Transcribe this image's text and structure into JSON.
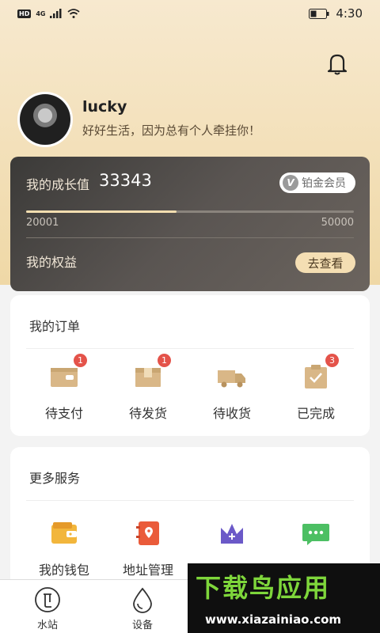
{
  "status_bar": {
    "hd": "HD",
    "network": "4G",
    "time": "4:30"
  },
  "profile": {
    "username": "lucky",
    "motto": "好好生活，因为总有个人牵挂你！"
  },
  "growth": {
    "label": "我的成长值",
    "value": "33343",
    "vip_level": "铂金会员",
    "vip_icon_letter": "V",
    "progress_min": "20001",
    "progress_max": "50000",
    "progress_fraction": 0.46,
    "benefits_label": "我的权益",
    "view_button": "去查看"
  },
  "orders": {
    "title": "我的订单",
    "items": [
      {
        "label": "待支付",
        "badge": "1",
        "icon": "wallet-card-icon"
      },
      {
        "label": "待发货",
        "badge": "1",
        "icon": "package-box-icon"
      },
      {
        "label": "待收货",
        "badge": "",
        "icon": "delivery-truck-icon"
      },
      {
        "label": "已完成",
        "badge": "3",
        "icon": "clipboard-check-icon"
      }
    ]
  },
  "services": {
    "title": "更多服务",
    "items": [
      {
        "label": "我的钱包",
        "icon": "wallet-icon"
      },
      {
        "label": "地址管理",
        "icon": "address-book-icon"
      },
      {
        "label": "",
        "icon": "crown-icon"
      },
      {
        "label": "",
        "icon": "message-icon"
      }
    ]
  },
  "tabs": [
    {
      "label": "水站",
      "icon": "water-station-icon"
    },
    {
      "label": "设备",
      "icon": "water-drop-icon"
    },
    {
      "label": "",
      "icon": "tab-3-icon"
    },
    {
      "label": "",
      "icon": "tab-4-icon"
    }
  ],
  "watermark": {
    "title": "下载鸟应用",
    "url": "www.xiazainiao.com"
  },
  "colors": {
    "header_gradient_top": "#f7e9cf",
    "header_gradient_bottom": "#efd8a6",
    "card_dark": "#4a4744",
    "accent_gold": "#f4deb3",
    "badge_red": "#e4534a",
    "order_icon_tan": "#d9b787"
  }
}
